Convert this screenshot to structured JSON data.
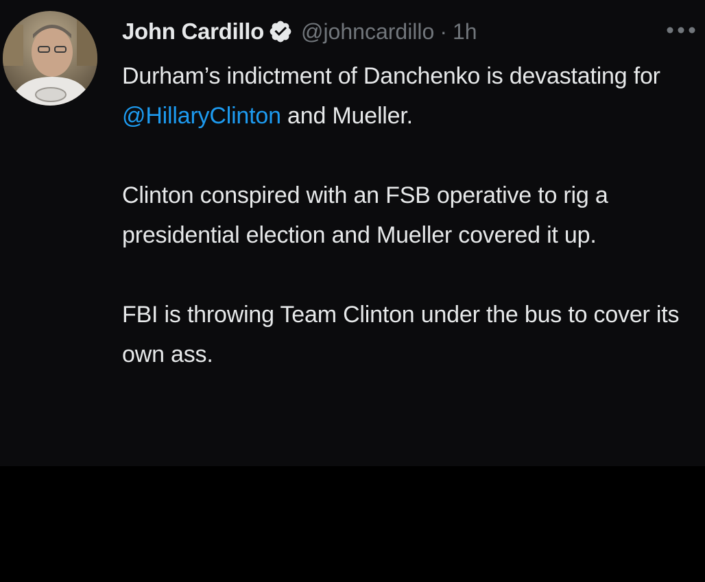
{
  "tweet": {
    "author": {
      "display_name": "John Cardillo",
      "handle": "@johncardillo",
      "verified": true,
      "avatar_icon": "profile-photo"
    },
    "separator": "·",
    "timestamp": "1h",
    "more_icon": "ellipsis-icon",
    "body": {
      "p1_before": "Durham’s indictment of Danchenko is devastating for ",
      "p1_mention": "@HillaryClinton",
      "p1_after": " and Mueller.",
      "p2": "Clinton conspired with an FSB operative to rig a presidential election and Mueller covered it up.",
      "p3": "FBI is throwing Team Clinton under the bus to cover its own ass."
    }
  },
  "colors": {
    "background": "#000000",
    "card": "#0b0b0d",
    "text": "#e7e9ea",
    "secondary_text": "#71767b",
    "link": "#1d9bf0"
  }
}
